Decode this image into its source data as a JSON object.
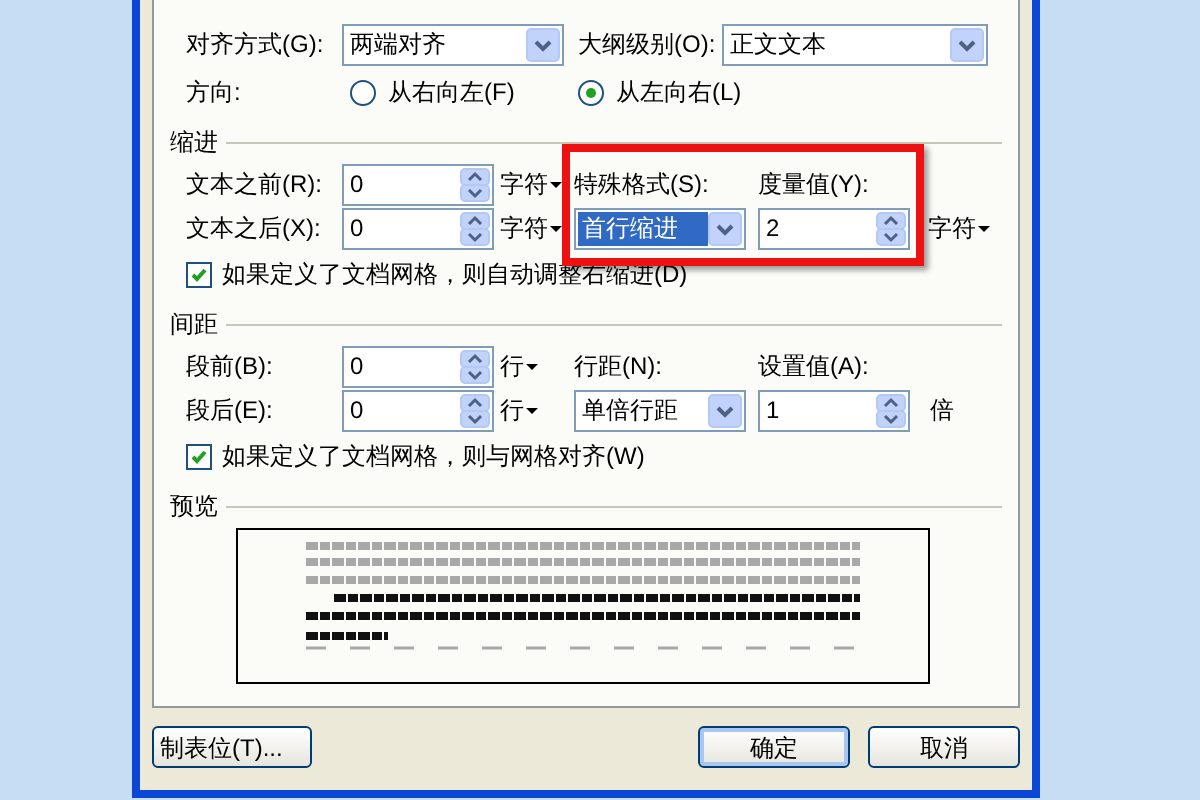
{
  "alignment": {
    "label": "对齐方式(G):",
    "value": "两端对齐"
  },
  "outline_level": {
    "label": "大纲级别(O):",
    "value": "正文文本"
  },
  "direction": {
    "label": "方向:",
    "options": [
      {
        "label": "从右向左(F)",
        "selected": false
      },
      {
        "label": "从左向右(L)",
        "selected": true
      }
    ]
  },
  "indent": {
    "title": "缩进",
    "rows": [
      {
        "label": "文本之前(R):",
        "value": "0",
        "unit": {
          "label": "字符",
          "menu": true
        }
      },
      {
        "label": "文本之后(X):",
        "value": "0",
        "unit": {
          "label": "字符",
          "menu": true
        }
      }
    ],
    "col3_label": "特殊格式(S):",
    "col3": {
      "value": "首行缩进",
      "focused": true
    },
    "col4_label": "度量值(Y):",
    "col4": {
      "value": "2",
      "unit": {
        "label": "字符",
        "menu": true
      }
    },
    "checkbox": {
      "label": "如果定义了文档网格，则自动调整右缩进(D)",
      "checked": true
    }
  },
  "spacing": {
    "title": "间距",
    "rows": [
      {
        "label": "段前(B):",
        "value": "0",
        "unit": {
          "label": "行",
          "menu": true
        }
      },
      {
        "label": "段后(E):",
        "value": "0",
        "unit": {
          "label": "行",
          "menu": true
        }
      }
    ],
    "col3_label": "行距(N):",
    "col3": {
      "value": "单倍行距",
      "focused": false
    },
    "col4_label": "设置值(A):",
    "col4": {
      "value": "1",
      "unit": {
        "label": "倍",
        "menu": false
      }
    },
    "checkbox": {
      "label": "如果定义了文档网格，则与网格对齐(W)",
      "checked": true
    }
  },
  "preview": {
    "title": "预览"
  },
  "buttons": [
    {
      "label": "制表位(T)...",
      "default": false
    },
    {
      "label": "确定",
      "default": true
    },
    {
      "label": "取消",
      "default": false
    }
  ]
}
